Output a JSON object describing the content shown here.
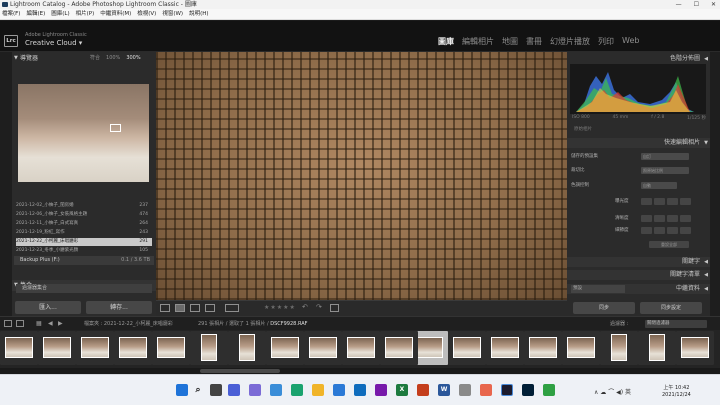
{
  "window": {
    "title": "Lightroom Catalog - Adobe Photoshop Lightroom Classic - 圖庫",
    "minimize": "—",
    "maximize": "☐",
    "close": "✕"
  },
  "menu": [
    "檔案(F)",
    "編輯(E)",
    "圖庫(L)",
    "相片(P)",
    "中繼資料(M)",
    "檢視(V)",
    "視窗(W)",
    "說明(H)"
  ],
  "identity": {
    "logo": "Lrc",
    "line1": "Adobe Lightroom Classic",
    "line2": "Creative Cloud ▾"
  },
  "modules": [
    "圖庫",
    "編輯相片",
    "地圖",
    "書冊",
    "幻燈片播放",
    "列印",
    "Web"
  ],
  "active_module": "圖庫",
  "navigator": {
    "title": "導覽器",
    "options": [
      "符合",
      "100%",
      "300%"
    ],
    "selected": "300%"
  },
  "folders": [
    {
      "name": "2021-12-02_小柚子_閨房婚",
      "count": "237"
    },
    {
      "name": "2021-12-06_小柚子_女裝風格主題",
      "count": "474"
    },
    {
      "name": "2021-12-11_小柚子_白式寫真",
      "count": "264"
    },
    {
      "name": "2021-12-19_粉紅_寫作",
      "count": "243"
    },
    {
      "name": "2021-12-22_小柯麗_床唱廳彩",
      "count": "291"
    },
    {
      "name": "2021-12-23_冬季_小廳紫光顏",
      "count": "105"
    }
  ],
  "selected_folder_index": 4,
  "volume": {
    "name": "Backup Plus (F:)",
    "space": "0.1 / 3.6 TB"
  },
  "collections": {
    "title": "集合",
    "item": "過濾器集合"
  },
  "left_buttons": {
    "import": "匯入...",
    "export": "轉存..."
  },
  "toolbar": {
    "stars": "★★★★★"
  },
  "histogram": {
    "title": "色階分佈圖",
    "iso": "ISO 800",
    "focal": "45 mm",
    "aperture": "f / 2.8",
    "shutter": "1/125 秒",
    "original": "原始相片"
  },
  "quick_develop": {
    "title": "快速編輯相片",
    "preset_label": "儲存的預設集",
    "preset_value": "自訂",
    "crop_label": "裁切比",
    "crop_value": "照原始比例",
    "treatment_label": "處理方式",
    "treatment_value": "彩色",
    "wb_label": "白平衡",
    "exposure_label": "色調控制",
    "auto_label": "自動",
    "rows": [
      "曝光度",
      "清晰度",
      "細節度"
    ],
    "reset": "重設全部"
  },
  "right_sections": [
    "關鍵字",
    "關鍵字清單",
    "中繼資料"
  ],
  "metadata_preset": "預設",
  "right_buttons": {
    "sync": "同步",
    "sync_settings": "同步設定"
  },
  "filmstrip": {
    "path": "檔案夾 : 2021-12-22_小柯麗_床唱廳彩",
    "count": "291 張相片 / 選取了 1 張相片 / ",
    "filename": "DSCF9928.RAF",
    "filter_label": "過濾器 :",
    "filter_value": "關閉過濾器",
    "thumbs": 19,
    "selected_index": 10
  },
  "taskbar": {
    "time": "上午 10:42",
    "date": "2021/12/24",
    "tray": "∧  ☁  ⌒ ◀) 英"
  },
  "colors": {
    "accent": "#e8e8e8",
    "panel": "#2b2b2b",
    "background": "#1b1b1b"
  }
}
